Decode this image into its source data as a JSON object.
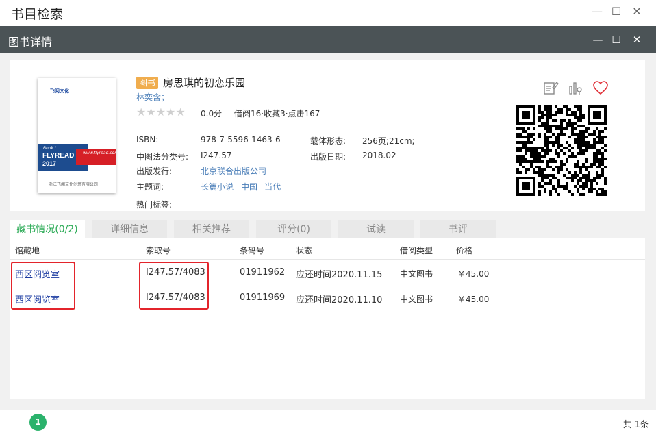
{
  "window": {
    "title": "书目检索",
    "minimize": "—",
    "maximize": "☐",
    "close": "✕"
  },
  "dialog": {
    "title": "图书详情",
    "minimize": "—",
    "maximize": "☐",
    "close": "✕"
  },
  "cover": {
    "logo_text": "飞阅文化",
    "book_label": "Book I",
    "brand": "FLYREAD",
    "year": "2017",
    "url": "www.flyread.com.cn",
    "publisher_text": "浙江飞阅文化创意有限公司"
  },
  "book": {
    "badge": "图书",
    "title": "房思琪的初恋乐园",
    "author": "林奕含；",
    "stars": "★★★★★",
    "rating": 0.0,
    "score_text": "0.0分",
    "stats": "借阅16·收藏3·点击167"
  },
  "fields": {
    "isbn_label": "ISBN:",
    "isbn": "978-7-5596-1463-6",
    "carrier_label": "载体形态:",
    "carrier": "256页;21cm;",
    "clc_label": "中图法分类号:",
    "clc": "I247.57",
    "pubdate_label": "出版日期:",
    "pubdate": "2018.02",
    "publisher_label": "出版发行:",
    "publisher": "北京联合出版公司",
    "subject_label": "主题词:",
    "subjects": [
      "长篇小说",
      "中国",
      "当代"
    ],
    "tags_label": "热门标签:"
  },
  "icons": {
    "note": "note-edit-icon",
    "chart": "stats-icon",
    "favorite": "heart-icon"
  },
  "colors": {
    "accent_green": "#2aaa55",
    "badge_orange": "#f0ad4e",
    "link_blue": "#4a7eb8",
    "highlight_red": "#e3242b",
    "dialog_bar": "#4b5356"
  },
  "tabs": [
    {
      "label": "藏书情况(0/2)",
      "active": true
    },
    {
      "label": "详细信息"
    },
    {
      "label": "相关推荐"
    },
    {
      "label": "评分(0)"
    },
    {
      "label": "试读"
    },
    {
      "label": "书评"
    }
  ],
  "holdings": {
    "headers": [
      "馆藏地",
      "索取号",
      "条码号",
      "状态",
      "借阅类型",
      "价格"
    ],
    "rows": [
      {
        "location": "西区阅览室",
        "call_no": "I247.57/4083",
        "barcode": "01911962",
        "status": "应还时间2020.11.15",
        "type": "中文图书",
        "price": "￥45.00"
      },
      {
        "location": "西区阅览室",
        "call_no": "I247.57/4083",
        "barcode": "01911969",
        "status": "应还时间2020.11.10",
        "type": "中文图书",
        "price": "￥45.00"
      }
    ]
  },
  "footer": {
    "page": "1",
    "total": "共 1条"
  }
}
